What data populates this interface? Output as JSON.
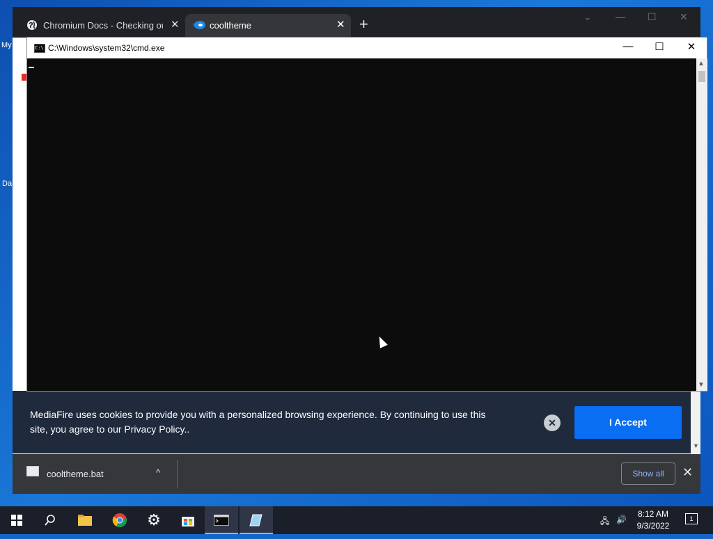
{
  "desktop": {
    "icon_label_1": "My",
    "icon_label_2": "Da"
  },
  "browser": {
    "tabs": [
      {
        "title": "Chromium Docs - Checking out a",
        "close": "✕"
      },
      {
        "title": "cooltheme",
        "close": "✕"
      }
    ],
    "new_tab": "+",
    "window_controls": {
      "minimize": "—",
      "maximize": "☐",
      "close": "✕",
      "tab_search": "⌄"
    }
  },
  "page": {
    "cookie_banner": {
      "text": "MediaFire uses cookies to provide you with a personalized browsing experience. By continuing to use this site, you agree to our Privacy Policy..",
      "dismiss": "✕",
      "accept_label": "I Accept"
    }
  },
  "downloads": {
    "file_name": "cooltheme.bat",
    "chevron": "^",
    "show_all": "Show all",
    "close": "✕"
  },
  "cmd_window": {
    "title": "C:\\Windows\\system32\\cmd.exe",
    "icon_text": "C:\\",
    "minimize": "—",
    "maximize": "☐",
    "close": "✕"
  },
  "taskbar": {
    "time": "8:12 AM",
    "date": "9/3/2022",
    "notification_count": "1"
  },
  "colors": {
    "cookie_bg": "#1f2a3d",
    "accept_button": "#0a6ef2",
    "show_all_text": "#8ab4f8",
    "cmd_bg": "#0c0c0c"
  }
}
